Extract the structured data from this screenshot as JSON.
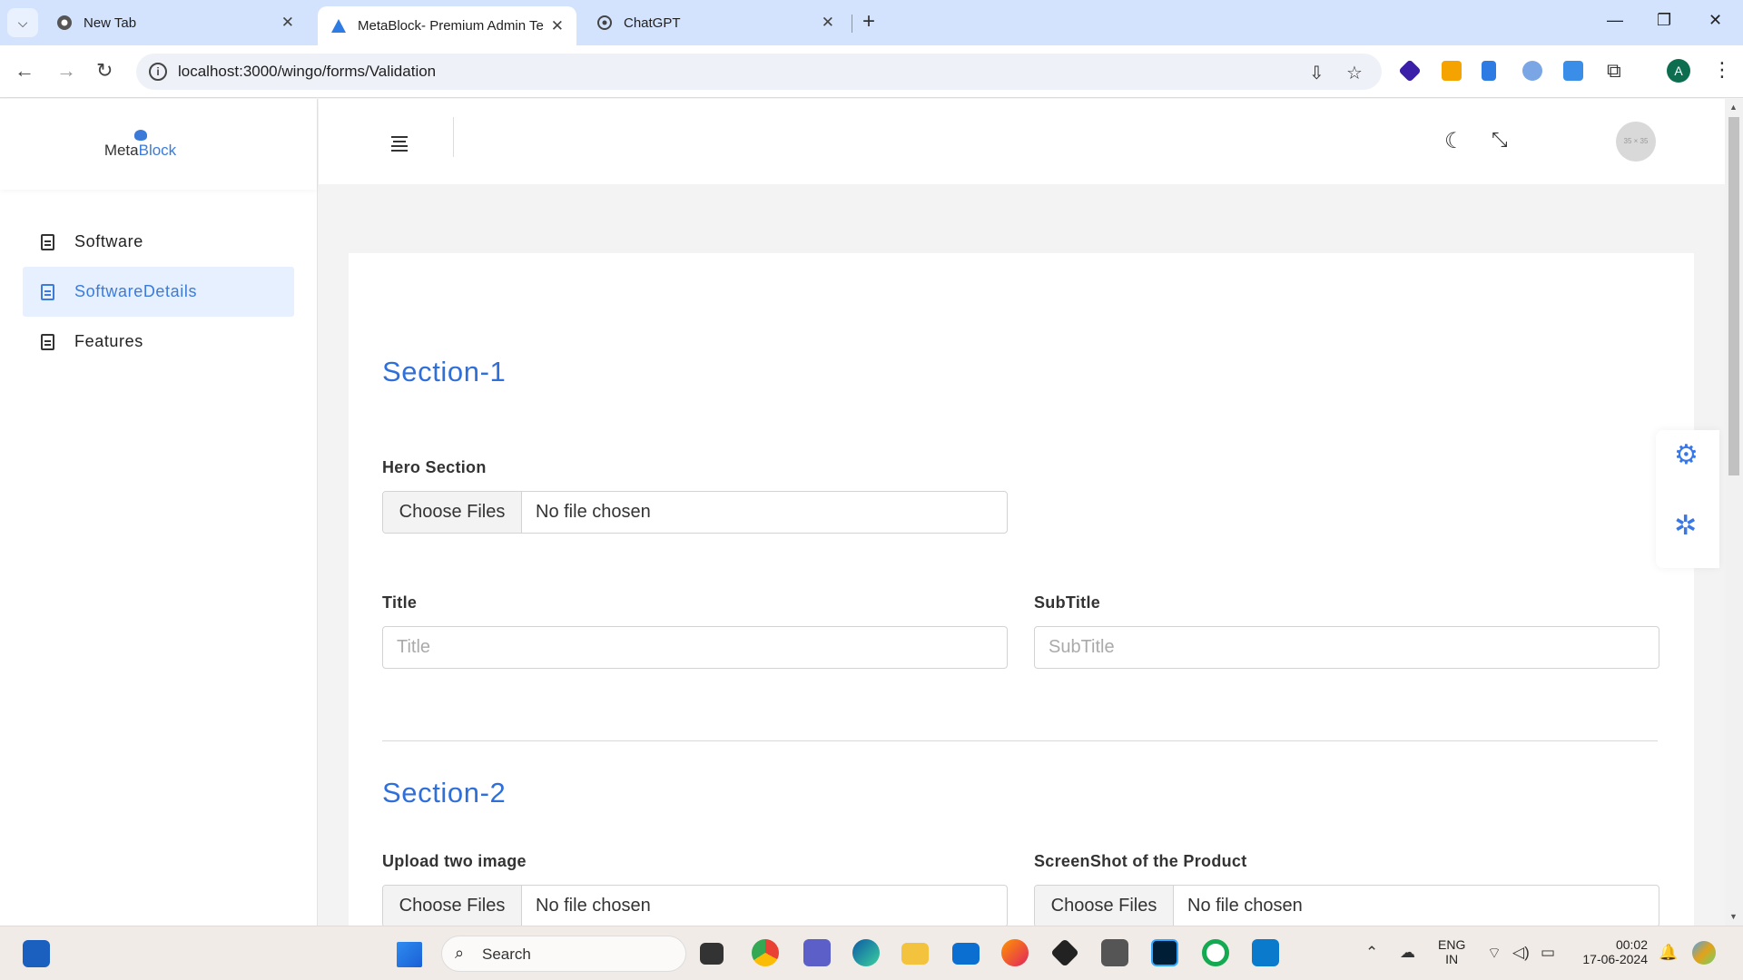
{
  "browser": {
    "tabs": [
      {
        "title": "New Tab",
        "active": false
      },
      {
        "title": "MetaBlock- Premium Admin Te",
        "active": true
      },
      {
        "title": "ChatGPT",
        "active": false
      }
    ],
    "url": "localhost:3000/wingo/forms/Validation",
    "profile_initial": "A"
  },
  "sidebar": {
    "logo_prefix": "Meta",
    "logo_suffix": "Block",
    "items": [
      {
        "label": "Software"
      },
      {
        "label": "SoftwareDetails"
      },
      {
        "label": "Features"
      }
    ]
  },
  "topbar": {
    "avatar_text": "35 × 35"
  },
  "form": {
    "section1": {
      "title": "Section-1",
      "hero_label": "Hero Section",
      "hero_button": "Choose Files",
      "hero_status": "No file chosen",
      "title_label": "Title",
      "title_placeholder": "Title",
      "subtitle_label": "SubTitle",
      "subtitle_placeholder": "SubTitle"
    },
    "section2": {
      "title": "Section-2",
      "upload_label": "Upload two image",
      "upload_button": "Choose Files",
      "upload_status": "No file chosen",
      "screenshot_label": "ScreenShot of the Product",
      "screenshot_button": "Choose Files",
      "screenshot_status": "No file chosen"
    }
  },
  "taskbar": {
    "search_label": "Search",
    "lang_line1": "ENG",
    "lang_line2": "IN",
    "time": "00:02",
    "date": "17-06-2024"
  },
  "colors": {
    "accent": "#2f6fd9",
    "active_bg": "#e7f0ff",
    "tabbar": "#d3e3fd"
  }
}
